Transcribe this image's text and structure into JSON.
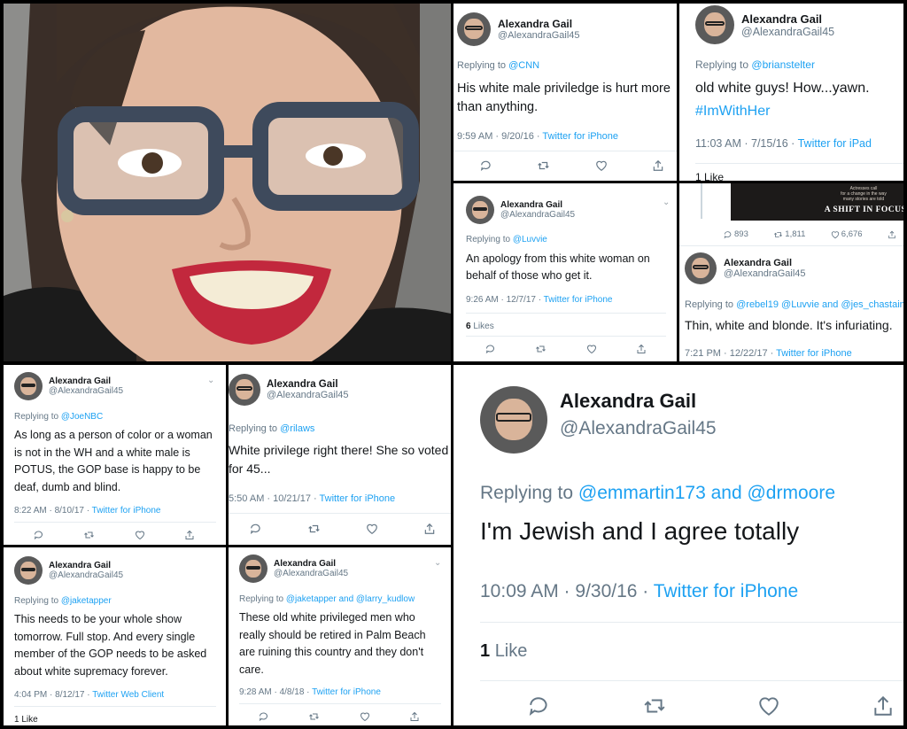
{
  "user": {
    "name": "Alexandra Gail",
    "handle": "@AlexandraGail45"
  },
  "tweets": {
    "t1": {
      "replying_label": "Replying to",
      "replying_to": "@CNN",
      "text": "His white male priviledge is hurt more than anything.",
      "time": "9:59 AM · 9/20/16 ·",
      "source": "Twitter for iPhone"
    },
    "t2": {
      "replying_label": "Replying to",
      "replying_to": "@brianstelter",
      "text": "old white guys!  How...yawn.",
      "hashtag": "#ImWithHer",
      "time": "11:03 AM · 7/15/16 ·",
      "source": "Twitter for iPad",
      "likes": "1 Like"
    },
    "t3": {
      "replying_label": "Replying to",
      "replying_to": "@Luvvie",
      "text": "An apology from this white woman on behalf of those who get it.",
      "time": "9:26 AM · 12/7/17 ·",
      "source": "Twitter for iPhone",
      "likes_count": "6",
      "likes_label": "Likes"
    },
    "t4": {
      "embed_line1": "Actresses call",
      "embed_line2": "for a change in the way",
      "embed_line3": "many stories are told",
      "embed_title": "A SHIFT IN FOCUS",
      "replies": "893",
      "retweets": "1,811",
      "likes": "6,676",
      "replying_label": "Replying to",
      "replying_to": "@rebel19 @Luvvie and @jes_chastain",
      "text": "Thin, white and blonde. It's infuriating.",
      "time": "7:21 PM · 12/22/17 ·",
      "source": "Twitter for iPhone"
    },
    "t5": {
      "replying_label": "Replying to",
      "replying_to": "@JoeNBC",
      "text": "As long as a person of color or a woman is not in the WH and a white male is POTUS, the GOP base is happy to be deaf, dumb and blind.",
      "time": "8:22 AM · 8/10/17 ·",
      "source": "Twitter for iPhone"
    },
    "t6": {
      "replying_label": "Replying to",
      "replying_to": "@rilaws",
      "text": "White privilege right there! She so voted for 45...",
      "time": "5:50 AM · 10/21/17 ·",
      "source": "Twitter for iPhone"
    },
    "t7": {
      "replying_label": "Replying to",
      "replying_to": "@emmartin173 and @drmoore",
      "text": "I'm Jewish and I agree totally",
      "time": "10:09 AM · 9/30/16 ·",
      "source": "Twitter for iPhone",
      "likes_count": "1",
      "likes_label": "Like"
    },
    "t8": {
      "replying_label": "Replying to",
      "replying_to": "@jaketapper",
      "text": "This needs to be your whole show tomorrow. Full stop. And every single member of the GOP needs to be asked about white supremacy forever.",
      "time": "4:04 PM · 8/12/17 ·",
      "source": "Twitter Web Client",
      "likes": "1 Like"
    },
    "t9": {
      "replying_label": "Replying to",
      "replying_to": "@jaketapper and @larry_kudlow",
      "text": "These old white privileged men who really should be retired in Palm Beach are ruining this country and they don't care.",
      "time": "9:28 AM · 4/8/18 ·",
      "source": "Twitter for iPhone"
    }
  },
  "icons": {
    "reply": "reply-icon",
    "retweet": "retweet-icon",
    "like": "heart-icon",
    "share": "share-icon",
    "chevron": "chevron-down-icon"
  },
  "colors": {
    "link": "#1da1f2",
    "muted": "#657786",
    "text": "#14171a"
  }
}
